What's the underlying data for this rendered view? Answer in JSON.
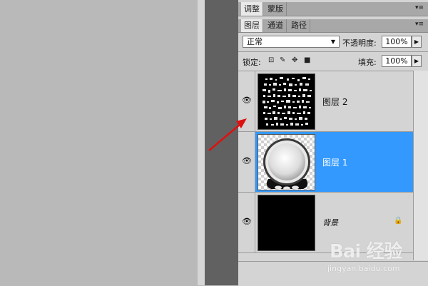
{
  "strip": {
    "button_glyph": "¶"
  },
  "panel_top": {
    "tabs": [
      {
        "label": "调整"
      },
      {
        "label": "蒙版"
      }
    ],
    "menu_glyph": "▾≡"
  },
  "layers_panel": {
    "tabs": [
      {
        "label": "图层"
      },
      {
        "label": "通道"
      },
      {
        "label": "路径"
      }
    ],
    "menu_glyph": "▾≡",
    "blend_mode": "正常",
    "opacity_label": "不透明度:",
    "opacity_value": "100%",
    "lock_label": "锁定:",
    "fill_label": "填充:",
    "fill_value": "100%",
    "layers": [
      {
        "name": "图层 2",
        "selected": false,
        "visible": true
      },
      {
        "name": "图层 1",
        "selected": true,
        "visible": true
      },
      {
        "name": "背景",
        "selected": false,
        "visible": true,
        "locked": true
      }
    ]
  },
  "watermark": {
    "brand": "Bai 经验",
    "url": "jingyan.baidu.com"
  },
  "colors": {
    "selection": "#3399ff",
    "annotation_arrow": "#dd1111"
  }
}
